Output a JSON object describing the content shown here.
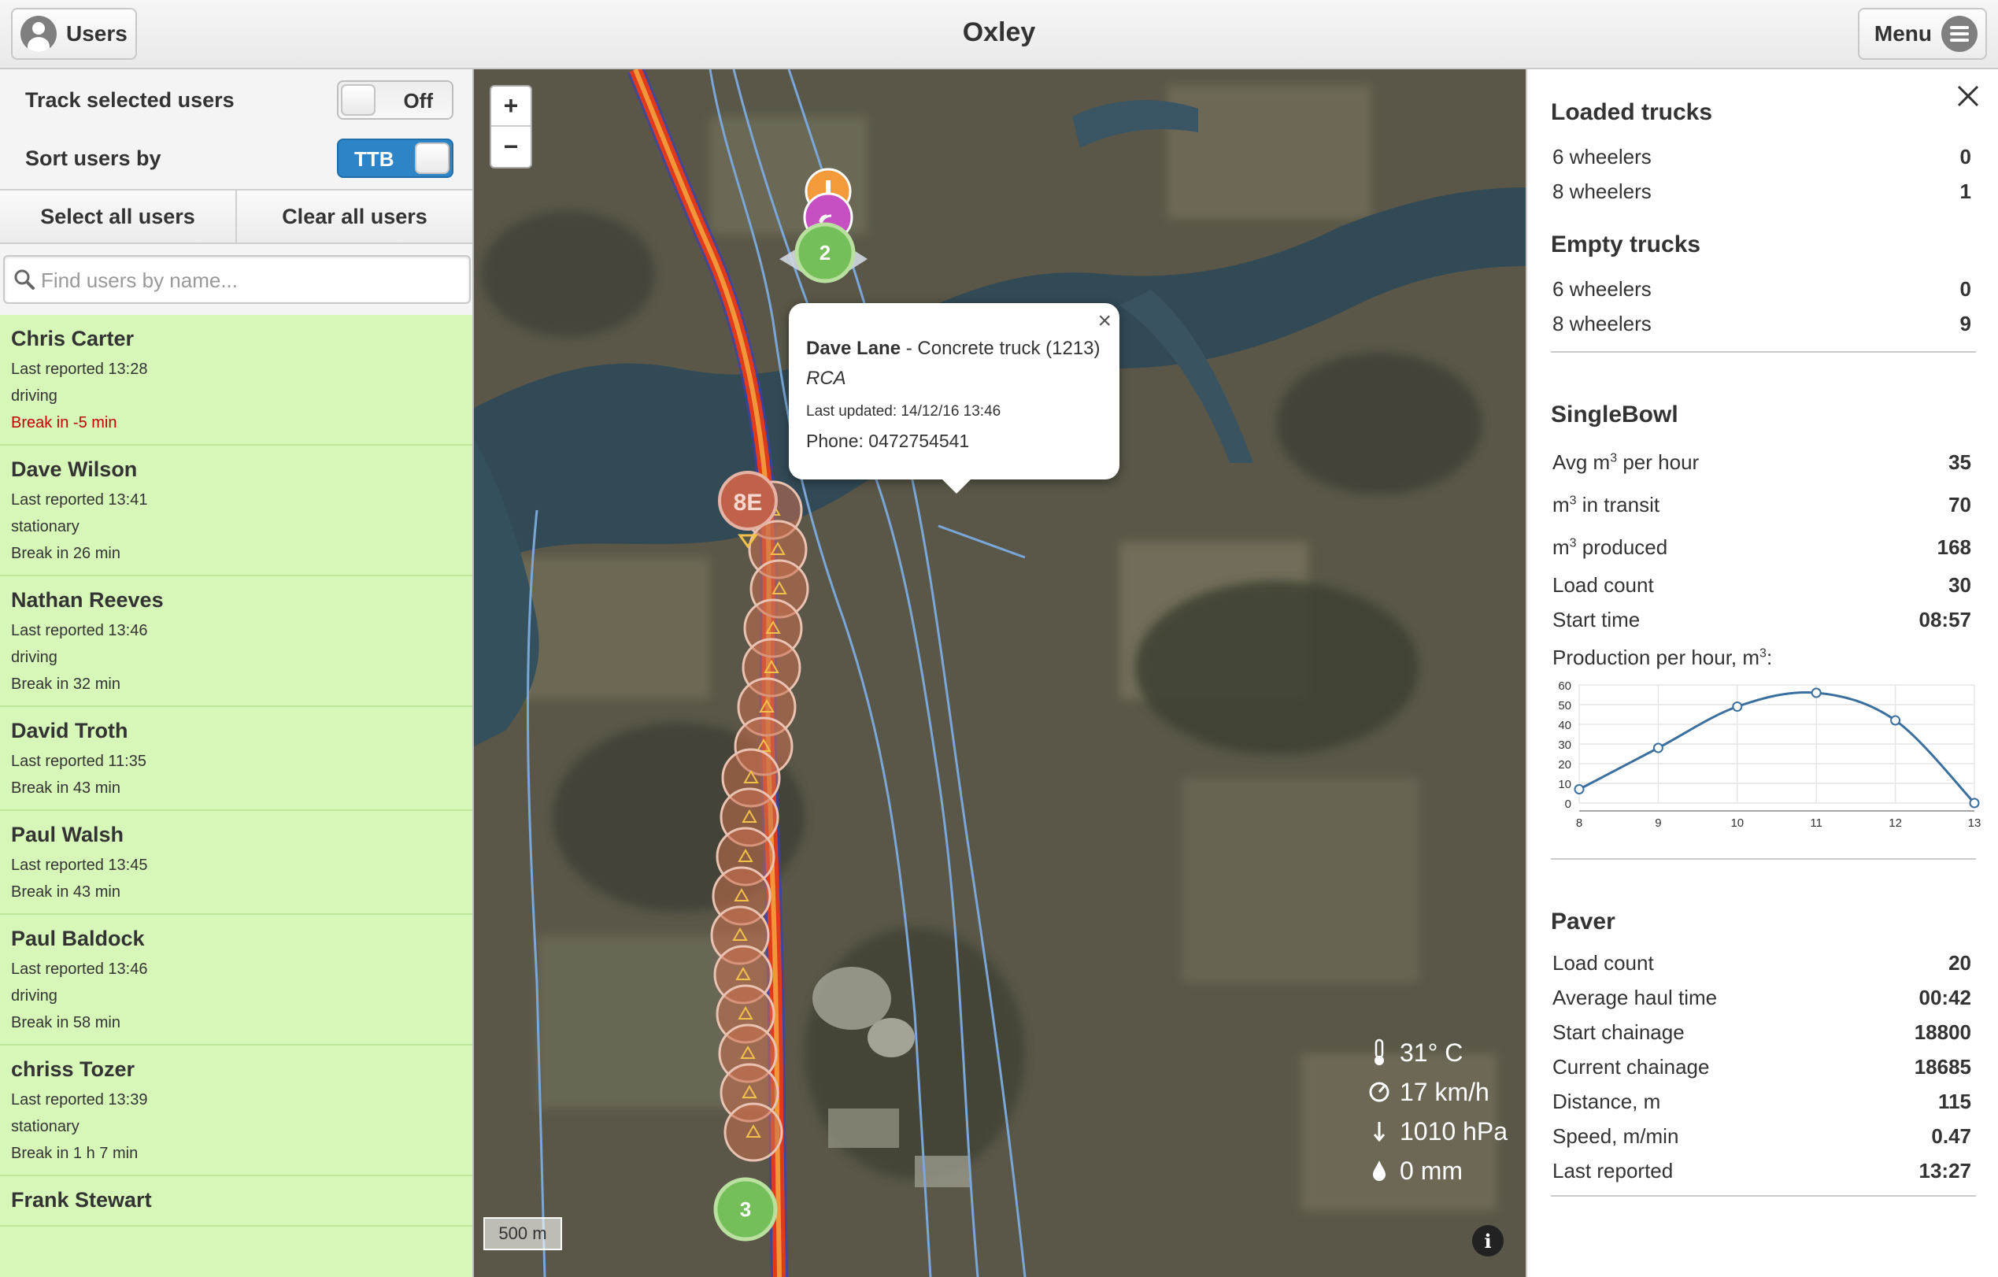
{
  "header": {
    "title": "Oxley",
    "users_label": "Users",
    "menu_label": "Menu"
  },
  "sidebar": {
    "track_label": "Track selected users",
    "track_toggle": "Off",
    "sort_label": "Sort users by",
    "sort_toggle": "TTB",
    "select_all": "Select all users",
    "clear_all": "Clear all users",
    "search_placeholder": "Find users by name..."
  },
  "users": [
    {
      "name": "Chris Carter",
      "reported": "Last reported 13:28",
      "status": "driving",
      "break": "Break in -5 min",
      "overdue": true
    },
    {
      "name": "Dave Wilson",
      "reported": "Last reported 13:41",
      "status": "stationary",
      "break": "Break in 26 min",
      "overdue": false
    },
    {
      "name": "Nathan Reeves",
      "reported": "Last reported 13:46",
      "status": "driving",
      "break": "Break in 32 min",
      "overdue": false
    },
    {
      "name": "David Troth",
      "reported": "Last reported 11:35",
      "status": "",
      "break": "Break in 43 min",
      "overdue": false
    },
    {
      "name": "Paul Walsh",
      "reported": "Last reported 13:45",
      "status": "",
      "break": "Break in 43 min",
      "overdue": false
    },
    {
      "name": "Paul Baldock",
      "reported": "Last reported 13:46",
      "status": "driving",
      "break": "Break in 58 min",
      "overdue": false
    },
    {
      "name": "chriss Tozer",
      "reported": "Last reported 13:39",
      "status": "stationary",
      "break": "Break in 1 h 7 min",
      "overdue": false
    },
    {
      "name": "Frank Stewart",
      "reported": "",
      "status": "",
      "break": "",
      "overdue": false
    }
  ],
  "map": {
    "zoom_in": "+",
    "zoom_out": "−",
    "popup": {
      "name": "Dave Lane",
      "vehicle": "- Concrete truck (1213)",
      "material": "RCA",
      "updated": "Last updated: 14/12/16 13:46",
      "phone": "Phone: 0472754541"
    },
    "markers": {
      "cluster_top": "2",
      "cluster_bottom": "3",
      "selected": "8E"
    },
    "weather": {
      "temperature": "31° C",
      "wind": "17 km/h",
      "pressure": "1010 hPa",
      "rain": "0 mm"
    },
    "scale": "500 m",
    "info": "i"
  },
  "panel": {
    "loaded": {
      "title": "Loaded trucks",
      "rows": [
        {
          "label": "6 wheelers",
          "value": "0"
        },
        {
          "label": "8 wheelers",
          "value": "1"
        }
      ]
    },
    "empty": {
      "title": "Empty trucks",
      "rows": [
        {
          "label": "6 wheelers",
          "value": "0"
        },
        {
          "label": "8 wheelers",
          "value": "9"
        }
      ]
    },
    "singlebowl": {
      "title": "SingleBowl",
      "avg_label": "Avg m",
      "avg_suffix": " per hour",
      "avg_value": "35",
      "transit_label": "m",
      "transit_suffix": " in transit",
      "transit_value": "70",
      "produced_label": "m",
      "produced_suffix": " produced",
      "produced_value": "168",
      "load_label": "Load count",
      "load_value": "30",
      "start_label": "Start time",
      "start_value": "08:57",
      "exponent": "3",
      "chart_title": "Production per hour, m",
      "chart_title_suffix": ":"
    },
    "paver": {
      "title": "Paver",
      "rows": [
        {
          "label": "Load count",
          "value": "20"
        },
        {
          "label": "Average haul time",
          "value": "00:42"
        },
        {
          "label": "Start chainage",
          "value": "18800"
        },
        {
          "label": "Current chainage",
          "value": "18685"
        },
        {
          "label": "Distance, m",
          "value": "115"
        },
        {
          "label": "Speed, m/min",
          "value": "0.47"
        },
        {
          "label": "Last reported",
          "value": "13:27"
        }
      ]
    }
  },
  "chart_data": {
    "type": "line",
    "title": "Production per hour, m³:",
    "x": [
      8,
      9,
      10,
      11,
      12,
      13
    ],
    "series": [
      {
        "values": [
          7,
          28,
          49,
          56,
          42,
          0
        ]
      }
    ],
    "xlim": [
      8,
      13
    ],
    "ylim": [
      0,
      60
    ],
    "yticks": [
      0,
      10,
      20,
      30,
      40,
      50,
      60
    ],
    "grid": true,
    "color": "#3a6f9e"
  }
}
